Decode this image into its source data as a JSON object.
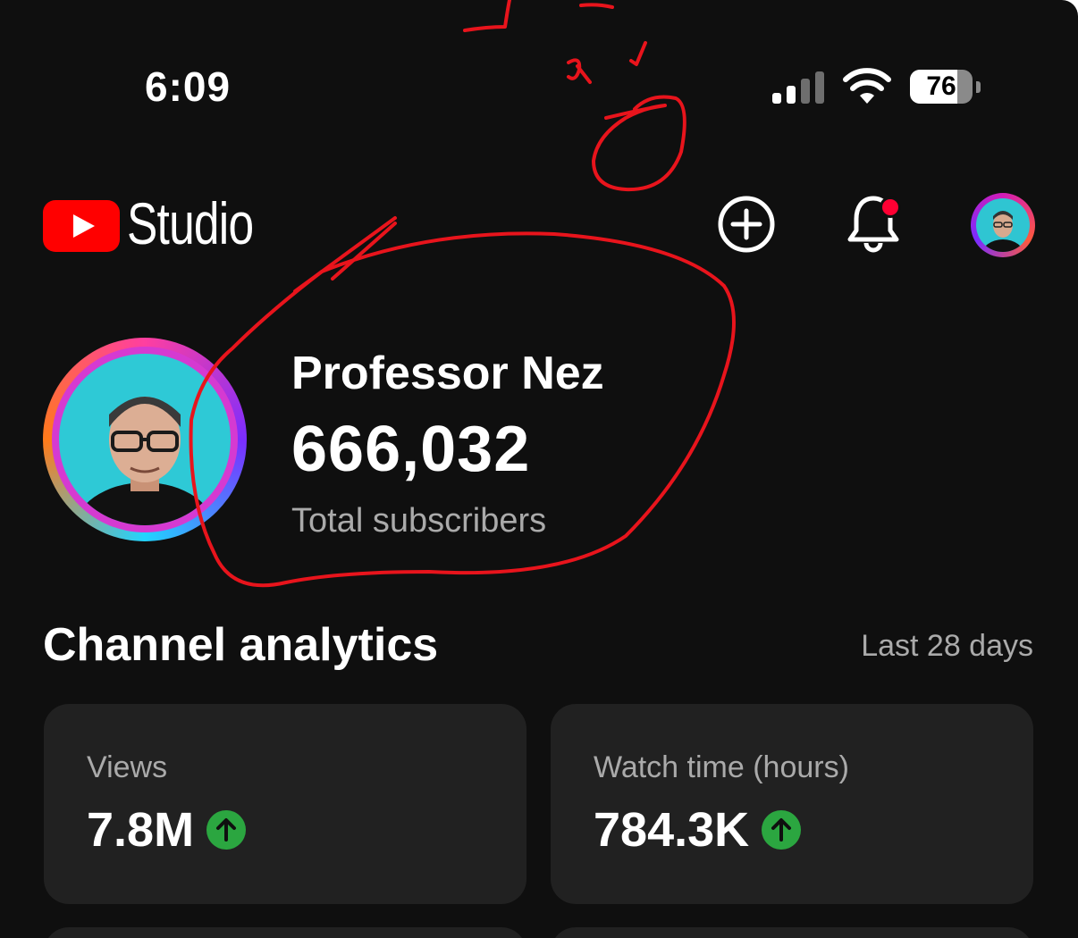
{
  "status_bar": {
    "time": "6:09",
    "battery": "76"
  },
  "header": {
    "app_name": "Studio"
  },
  "channel": {
    "name": "Professor Nez",
    "subscribers": "666,032",
    "subscribers_label": "Total subscribers"
  },
  "analytics": {
    "title": "Channel analytics",
    "period": "Last 28 days",
    "cards": [
      {
        "label": "Views",
        "value": "7.8M",
        "trend": "up"
      },
      {
        "label": "Watch time (hours)",
        "value": "784.3K",
        "trend": "up"
      }
    ]
  },
  "colors": {
    "background": "#0f0f0f",
    "card": "#212121",
    "brand_red": "#ff0000",
    "trend_green": "#2ba640",
    "annotation_red": "#e8141c"
  }
}
